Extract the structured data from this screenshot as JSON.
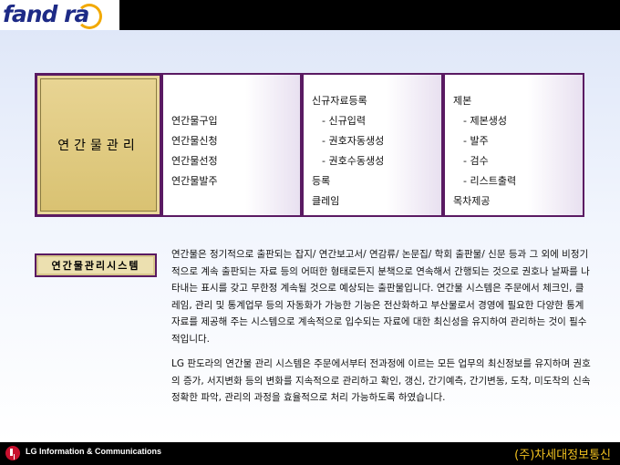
{
  "header": {
    "logo_text": "fand ra",
    "logo_icon": "pandora-swoosh-icon"
  },
  "panels": {
    "title": "연간물관리",
    "col2": [
      "연간물구입",
      "연간물신청",
      "연간물선정",
      "연간물발주"
    ],
    "col3": [
      "신규자료등록",
      "-  신규입력",
      "-  권호자동생성",
      "-  권호수동생성",
      "등록",
      "클레임"
    ],
    "col4": [
      "제본",
      "- 제본생성",
      "- 발주",
      "- 검수",
      "- 리스트출력",
      "목차제공"
    ]
  },
  "system": {
    "label": "연간물관리시스템",
    "paragraph1": "연간물은 정기적으로 출판되는 잡지/ 연간보고서/ 연감류/ 논문집/ 학회 출판물/ 신문 등과 그 외에 비정기적으로 계속 출판되는 자료 등의 어떠한 형태로든지 분책으로 연속해서 간행되는 것으로 권호나 날짜를 나타내는 표시를 갖고 무한정 계속될 것으로 예상되는 출판물입니다. 연간물 시스템은 주문에서 체크인, 클레임, 관리 및 통계업무 등의 자동화가 가능한 기능은 전산화하고 부산물로서 경영에 필요한 다양한 통계 자료를 제공해 주는 시스템으로 계속적으로 입수되는 자료에 대한 최신성을 유지하여 관리하는 것이 필수적입니다.",
    "paragraph2": "LG 판도라의 연간물 관리 시스템은 주문에서부터 전과정에 이르는 모든 업무의 최신정보를 유지하며 권호의 증가, 서지변화 등의 변화를 지속적으로 관리하고 확인, 갱신, 간기예측, 간기변동, 도착, 미도착의 신속 정확한 파악, 관리의 과정을 효율적으로 처리 가능하도록 하였습니다."
  },
  "footer": {
    "lg_logo": "lg-logo-icon",
    "brand": "LG Information & Communications",
    "company": "(주)차세대정보통신"
  },
  "colors": {
    "frame": "#5a1a62",
    "title_fill": "#e8d493",
    "company_text": "#f0c020"
  }
}
